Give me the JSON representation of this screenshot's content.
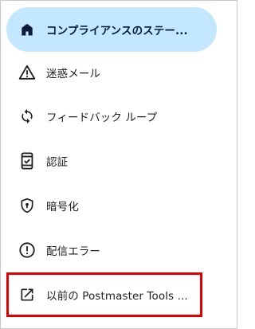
{
  "nav": {
    "items": [
      {
        "label": "コンプライアンスのステー...",
        "icon": "home-icon",
        "active": true
      },
      {
        "label": "迷惑メール",
        "icon": "warning-icon",
        "active": false
      },
      {
        "label": "フィードバック ループ",
        "icon": "sync-icon",
        "active": false
      },
      {
        "label": "認証",
        "icon": "phone-check-icon",
        "active": false
      },
      {
        "label": "暗号化",
        "icon": "shield-lock-icon",
        "active": false
      },
      {
        "label": "配信エラー",
        "icon": "error-icon",
        "active": false
      },
      {
        "label": "以前の Postmaster Tools ...",
        "icon": "open-in-new-icon",
        "active": false
      }
    ]
  },
  "colors": {
    "active_bg": "#c2e7ff",
    "highlight_border": "#e00000",
    "icon": "#1f1f1f"
  }
}
